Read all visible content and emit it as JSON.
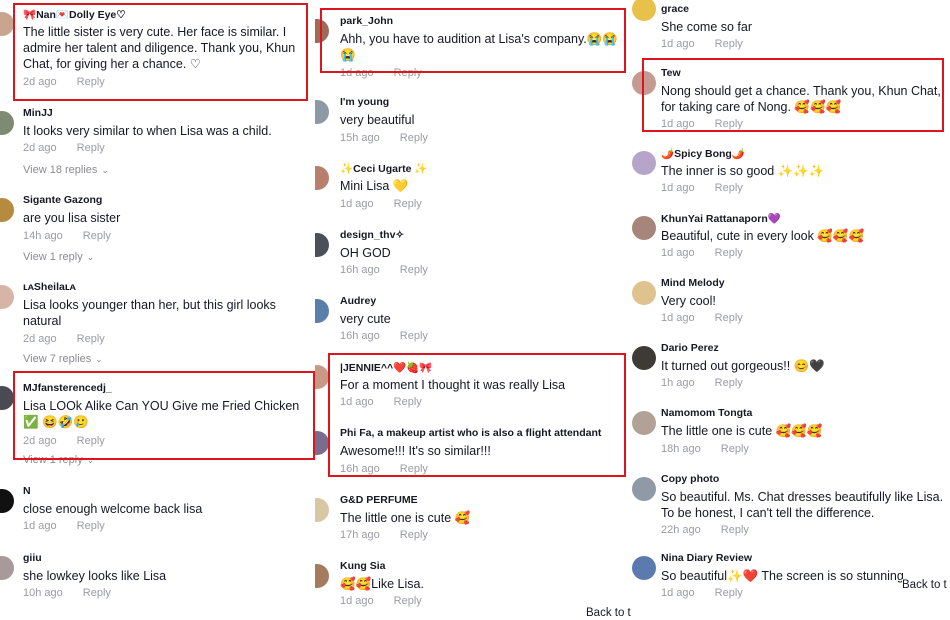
{
  "reply_label": "Reply",
  "back_label": "Back to t",
  "highlight_color": "#e0141e",
  "columns": [
    {
      "comments": [
        {
          "username": "🎀Nan💌Dolly Eye♡",
          "text": "The little sister is very cute. Her face is similar. I admire her talent and diligence. Thank you, Khun Chat, for giving her a chance. ♡",
          "age": "2d ago",
          "avatar_color": "#c9a58f"
        },
        {
          "username": "MinJJ",
          "text": "It looks very similar to when Lisa was a child.",
          "age": "2d ago",
          "view_replies": "View 18 replies",
          "avatar_color": "#7f8a72"
        },
        {
          "username": "Sigante Gazong",
          "text": "are you lisa sister",
          "age": "14h ago",
          "view_replies": "View 1 reply",
          "avatar_color": "#b58b3f"
        },
        {
          "username": "ʟᴀSheilaʟᴀ",
          "text": "Lisa looks younger than her, but this girl looks natural",
          "age": "2d ago",
          "view_replies": "View 7 replies",
          "avatar_color": "#d7b5a6"
        },
        {
          "username": "MJfansterencedj_",
          "text": "Lisa LOOk Alike Can YOU Give me Fried Chicken ✅ 😆🤣🥲",
          "age": "2d ago",
          "view_replies": "View 1 reply",
          "avatar_color": "#4a4a52"
        },
        {
          "username": "N",
          "text": "close enough welcome back lisa",
          "age": "1d ago",
          "avatar_color": "#111111"
        },
        {
          "username": "giiu",
          "text": "she lowkey looks like Lisa",
          "age": "10h ago",
          "avatar_color": "#a89a9a"
        }
      ]
    },
    {
      "comments": [
        {
          "username": "park_John",
          "text": "Ahh, you have to audition at Lisa's company.😭😭😭",
          "age": "1d ago",
          "avatar_color": "#9c6b5a"
        },
        {
          "username": "I'm young",
          "text": "very beautiful",
          "age": "15h ago",
          "avatar_color": "#8c9aa5"
        },
        {
          "username": "✨Ceci Ugarte ✨",
          "text": "Mini Lisa 💛",
          "age": "1d ago",
          "avatar_color": "#b97f6d"
        },
        {
          "username": "design_thv✧",
          "text": "OH GOD",
          "age": "16h ago",
          "avatar_color": "#4b4f5a"
        },
        {
          "username": "Audrey",
          "text": "very cute",
          "age": "16h ago",
          "avatar_color": "#5a7fa8"
        },
        {
          "username": "|JENNIE^^❤️🍓🎀",
          "text": "For a moment I thought it was really Lisa",
          "age": "1d ago",
          "avatar_color": "#c89a86"
        },
        {
          "username": "Phi Fa, a makeup artist who is also a flight attendant",
          "text": "Awesome!!! It's so similar!!!",
          "age": "16h ago",
          "avatar_color": "#7a6c8e"
        },
        {
          "username": "G&D PERFUME",
          "text": "The little one is cute 🥰",
          "age": "17h ago",
          "avatar_color": "#d9c7a3"
        },
        {
          "username": "Kung Sia",
          "text": "🥰🥰Like Lisa.",
          "age": "1d ago",
          "avatar_color": "#a47b5c"
        }
      ]
    },
    {
      "comments": [
        {
          "username": "grace",
          "text": "She come so far",
          "age": "1d ago",
          "avatar_color": "#e8c14a"
        },
        {
          "username": "Tew",
          "text": "Nong should get a chance. Thank you, Khun Chat, for taking care of Nong. 🥰🥰🥰",
          "age": "1d ago",
          "avatar_color": "#c59a90"
        },
        {
          "username": "🌶️Spicy Bong🌶️",
          "text": "The inner is so good ✨✨✨",
          "age": "1d ago",
          "avatar_color": "#b7a5c9"
        },
        {
          "username": "KhunYai Rattanaporn💜",
          "text": "Beautiful, cute in every look 🥰🥰🥰",
          "age": "1d ago",
          "avatar_color": "#a6867a"
        },
        {
          "username": "Mind Melody",
          "text": "Very cool!",
          "age": "1d ago",
          "avatar_color": "#e0c28f"
        },
        {
          "username": "Dario Perez",
          "text": "It turned out gorgeous!! 😊🖤",
          "age": "1h ago",
          "avatar_color": "#3e3a36"
        },
        {
          "username": "Namomom Tongta",
          "text": "The little one is cute 🥰🥰🥰",
          "age": "18h ago",
          "avatar_color": "#b2a196"
        },
        {
          "username": "Copy photo",
          "text": "So beautiful. Ms. Chat dresses beautifully like Lisa. To be honest, I can't tell the difference.",
          "age": "22h ago",
          "avatar_color": "#8f9aa6"
        },
        {
          "username": "Nina Diary Review",
          "text": "So beautiful✨❤️ The screen is so stunning",
          "age": "1d ago",
          "avatar_color": "#5b7bb0"
        }
      ]
    }
  ]
}
